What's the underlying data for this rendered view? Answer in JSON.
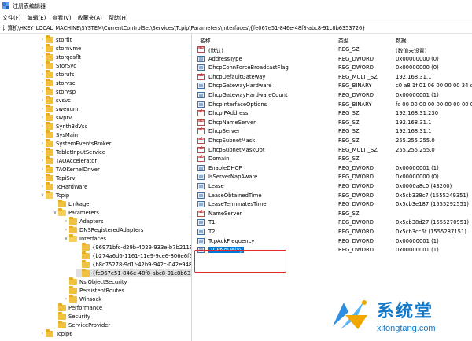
{
  "window": {
    "title": "注册表编辑器"
  },
  "menu": [
    "文件(F)",
    "编辑(E)",
    "查看(V)",
    "收藏夹(A)",
    "帮助(H)"
  ],
  "address": "计算机\\HKEY_LOCAL_MACHINE\\SYSTEM\\CurrentControlSet\\Services\\Tcpip\\Parameters\\Interfaces\\{fe067e51-846e-48f8-abc8-91c8b6353726}",
  "tree": [
    {
      "label": "storflt",
      "depth": 0,
      "exp": ">"
    },
    {
      "label": "stornvme",
      "depth": 0,
      "exp": ">"
    },
    {
      "label": "storqosflt",
      "depth": 0,
      "exp": ">"
    },
    {
      "label": "StorSvc",
      "depth": 0,
      "exp": ">"
    },
    {
      "label": "storufs",
      "depth": 0,
      "exp": ">"
    },
    {
      "label": "storvsc",
      "depth": 0,
      "exp": ">"
    },
    {
      "label": "storvsp",
      "depth": 0,
      "exp": ">"
    },
    {
      "label": "svsvc",
      "depth": 0,
      "exp": ">"
    },
    {
      "label": "swenum",
      "depth": 0,
      "exp": ">"
    },
    {
      "label": "swprv",
      "depth": 0,
      "exp": ">"
    },
    {
      "label": "Synth3dVsc",
      "depth": 0,
      "exp": ">"
    },
    {
      "label": "SysMain",
      "depth": 0,
      "exp": ">"
    },
    {
      "label": "SystemEventsBroker",
      "depth": 0,
      "exp": ">"
    },
    {
      "label": "TabletInputService",
      "depth": 0,
      "exp": ">"
    },
    {
      "label": "TAOAccelerator",
      "depth": 0,
      "exp": ">"
    },
    {
      "label": "TAOKernelDriver",
      "depth": 0,
      "exp": ">"
    },
    {
      "label": "TapiSrv",
      "depth": 0,
      "exp": ">"
    },
    {
      "label": "TcHardWare",
      "depth": 0,
      "exp": ">"
    },
    {
      "label": "Tcpip",
      "depth": 0,
      "exp": "v"
    },
    {
      "label": "Linkage",
      "depth": 1,
      "exp": ""
    },
    {
      "label": "Parameters",
      "depth": 1,
      "exp": "v"
    },
    {
      "label": "Adapters",
      "depth": 2,
      "exp": ">"
    },
    {
      "label": "DNSRegisteredAdapters",
      "depth": 2,
      "exp": ">"
    },
    {
      "label": "Interfaces",
      "depth": 2,
      "exp": "v"
    },
    {
      "label": "{96971bfc-d29b-4029-933e-b7b21191e3a9",
      "depth": 3,
      "exp": ""
    },
    {
      "label": "{b274a6d6-1161-11e9-9ce6-806e6f6e6963",
      "depth": 3,
      "exp": ""
    },
    {
      "label": "{b8c75278-9d1f-42b9-942c-042e9480916d",
      "depth": 3,
      "exp": ""
    },
    {
      "label": "{fe067e51-846e-48f8-abc8-91c8b6353726}",
      "depth": 3,
      "exp": "",
      "selected": true
    },
    {
      "label": "NsiObjectSecurity",
      "depth": 2,
      "exp": ""
    },
    {
      "label": "PersistentRoutes",
      "depth": 2,
      "exp": ""
    },
    {
      "label": "Winsock",
      "depth": 2,
      "exp": ">"
    },
    {
      "label": "Performance",
      "depth": 1,
      "exp": ""
    },
    {
      "label": "Security",
      "depth": 1,
      "exp": ""
    },
    {
      "label": "ServiceProvider",
      "depth": 1,
      "exp": ""
    },
    {
      "label": "Tcpip6",
      "depth": 0,
      "exp": ">"
    }
  ],
  "columns": {
    "name": "名称",
    "type": "类型",
    "data": "数据"
  },
  "values": [
    {
      "name": "(默认)",
      "type": "REG_SZ",
      "data": "(数值未设置)",
      "icon": "ab"
    },
    {
      "name": "AddressType",
      "type": "REG_DWORD",
      "data": "0x00000000 (0)",
      "icon": "bin"
    },
    {
      "name": "DhcpConnForceBroadcastFlag",
      "type": "REG_DWORD",
      "data": "0x00000000 (0)",
      "icon": "bin"
    },
    {
      "name": "DhcpDefaultGateway",
      "type": "REG_MULTI_SZ",
      "data": "192.168.31.1",
      "icon": "ab"
    },
    {
      "name": "DhcpGatewayHardware",
      "type": "REG_BINARY",
      "data": "c0 a8 1f 01 06 00 00 00 34 ce 0",
      "icon": "bin"
    },
    {
      "name": "DhcpGatewayHardwareCount",
      "type": "REG_DWORD",
      "data": "0x00000001 (1)",
      "icon": "bin"
    },
    {
      "name": "DhcpInterfaceOptions",
      "type": "REG_BINARY",
      "data": "fc 00 00 00 00 00 00 00 00 00 0",
      "icon": "bin"
    },
    {
      "name": "DhcpIPAddress",
      "type": "REG_SZ",
      "data": "192.168.31.230",
      "icon": "ab"
    },
    {
      "name": "DhcpNameServer",
      "type": "REG_SZ",
      "data": "192.168.31.1",
      "icon": "ab"
    },
    {
      "name": "DhcpServer",
      "type": "REG_SZ",
      "data": "192.168.31.1",
      "icon": "ab"
    },
    {
      "name": "DhcpSubnetMask",
      "type": "REG_SZ",
      "data": "255.255.255.0",
      "icon": "ab"
    },
    {
      "name": "DhcpSubnetMaskOpt",
      "type": "REG_MULTI_SZ",
      "data": "255.255.255.0",
      "icon": "ab"
    },
    {
      "name": "Domain",
      "type": "REG_SZ",
      "data": "",
      "icon": "ab"
    },
    {
      "name": "EnableDHCP",
      "type": "REG_DWORD",
      "data": "0x00000001 (1)",
      "icon": "bin"
    },
    {
      "name": "IsServerNapAware",
      "type": "REG_DWORD",
      "data": "0x00000000 (0)",
      "icon": "bin"
    },
    {
      "name": "Lease",
      "type": "REG_DWORD",
      "data": "0x0000a8c0 (43200)",
      "icon": "bin"
    },
    {
      "name": "LeaseObtainedTime",
      "type": "REG_DWORD",
      "data": "0x5cb338c7 (1555249351)",
      "icon": "bin"
    },
    {
      "name": "LeaseTerminatesTime",
      "type": "REG_DWORD",
      "data": "0x5cb3e187 (1555292551)",
      "icon": "bin"
    },
    {
      "name": "NameServer",
      "type": "REG_SZ",
      "data": "",
      "icon": "ab"
    },
    {
      "name": "T1",
      "type": "REG_DWORD",
      "data": "0x5cb38d27 (1555270951)",
      "icon": "bin"
    },
    {
      "name": "T2",
      "type": "REG_DWORD",
      "data": "0x5cb3cc6f (1555287151)",
      "icon": "bin"
    },
    {
      "name": "TcpAckFrequency",
      "type": "REG_DWORD",
      "data": "0x00000001 (1)",
      "icon": "bin"
    },
    {
      "name": "TCPNoDelay",
      "type": "REG_DWORD",
      "data": "0x00000001 (1)",
      "icon": "bin",
      "selected": true
    }
  ],
  "watermark": {
    "brand": "系统堂",
    "site": "xitongtang.com"
  },
  "colors": {
    "selection": "#0078d7",
    "highlight_box": "#e0292b",
    "folder": "#f0c13e",
    "brand": "#1479c8"
  }
}
